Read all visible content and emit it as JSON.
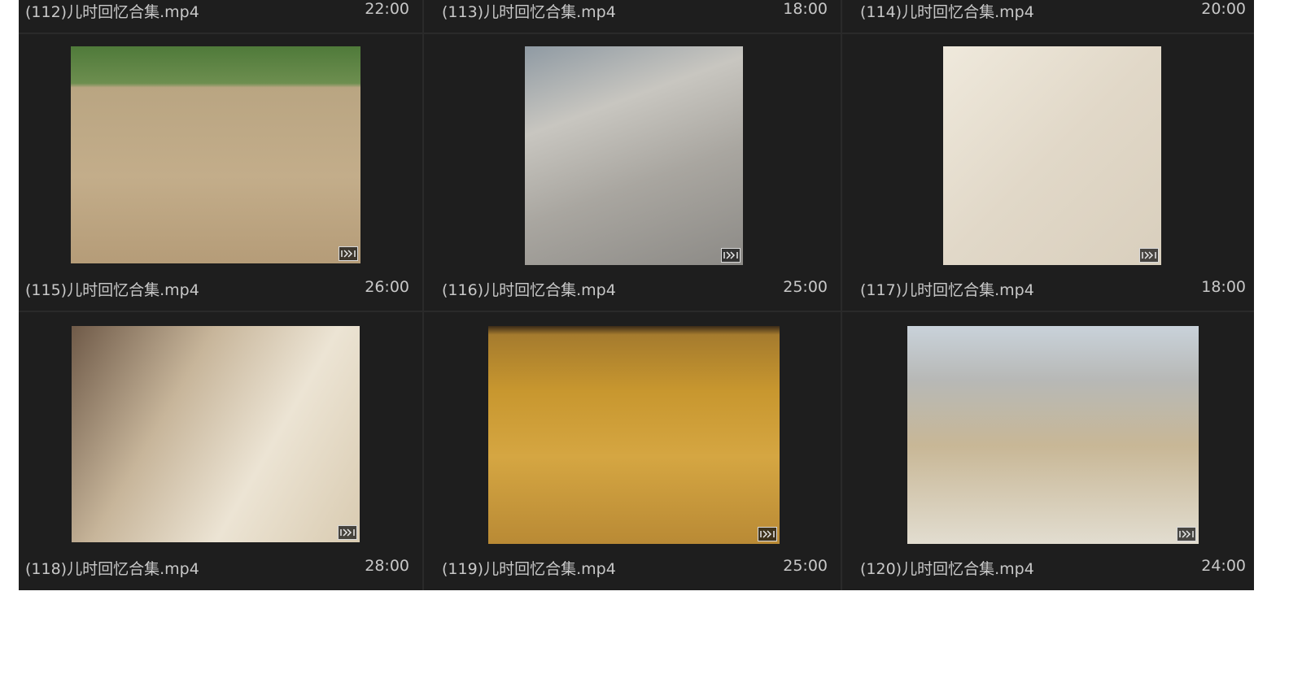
{
  "top_row": [
    {
      "label": "(112)儿时回忆合集.mp4",
      "duration": "22:00"
    },
    {
      "label": "(113)儿时回忆合集.mp4",
      "duration": "18:00"
    },
    {
      "label": "(114)儿时回忆合集.mp4",
      "duration": "20:00"
    }
  ],
  "items": [
    {
      "label": "(115)儿时回忆合集.mp4",
      "duration": "26:00",
      "icon": "film-icon"
    },
    {
      "label": "(116)儿时回忆合集.mp4",
      "duration": "25:00",
      "icon": "film-icon"
    },
    {
      "label": "(117)儿时回忆合集.mp4",
      "duration": "18:00",
      "icon": "film-icon"
    },
    {
      "label": "(118)儿时回忆合集.mp4",
      "duration": "28:00",
      "icon": "film-icon"
    },
    {
      "label": "(119)儿时回忆合集.mp4",
      "duration": "25:00",
      "icon": "film-icon"
    },
    {
      "label": "(120)儿时回忆合集.mp4",
      "duration": "24:00",
      "icon": "film-icon"
    }
  ],
  "colors": {
    "panel_background": "#1e1e1e",
    "label_text": "#c8c8c8"
  }
}
